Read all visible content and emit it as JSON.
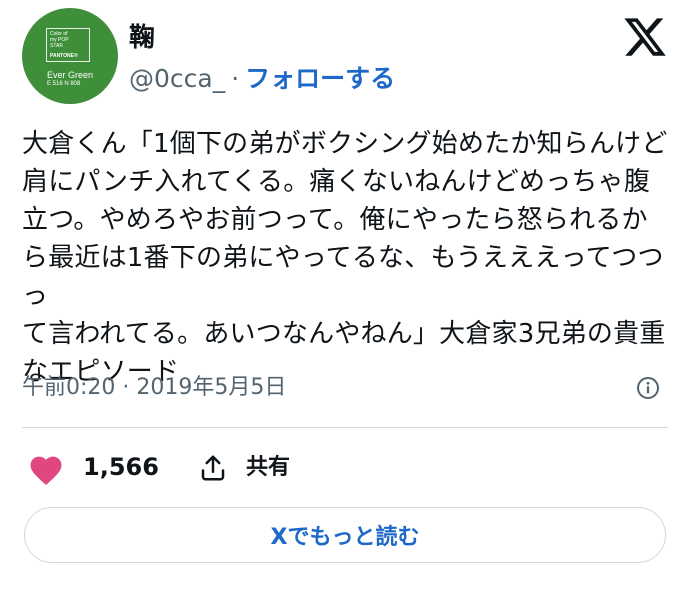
{
  "header": {
    "name": "鞠",
    "handle": "@0cca_",
    "separator": "·",
    "follow_label": "フォローする"
  },
  "avatar": {
    "swatch_lines": [
      "Color of",
      "my POP",
      "STAR"
    ],
    "swatch_brand": "PANTONE®",
    "caption_name": "Ever Green",
    "caption_code": "E 516 N 808",
    "bg_color": "#3f8f3a"
  },
  "tweet": {
    "text": "大倉くん「1個下の弟がボクシング始めたか知らんけど\n肩にパンチ入れてくる。痛くないねんけどめっちゃ腹\n立つ。やめろやお前つって。俺にやったら怒られるか\nら最近は1番下の弟にやってるな、もうえええってつつっ\nて言われてる。あいつなんやねん」大倉家3兄弟の貴重\nなエピソード",
    "timestamp": "午前0:20 · 2019年5月5日"
  },
  "actions": {
    "like_count": "1,566",
    "share_label": "共有",
    "read_more_label": "Xでもっと読む"
  },
  "icons": {
    "logo": "x-logo-icon",
    "info": "info-icon",
    "like": "heart-icon",
    "share": "share-icon"
  },
  "colors": {
    "link": "#1d68c8",
    "secondary_text": "#536471",
    "heart": "#e0467f",
    "divider": "#cfd9de"
  }
}
